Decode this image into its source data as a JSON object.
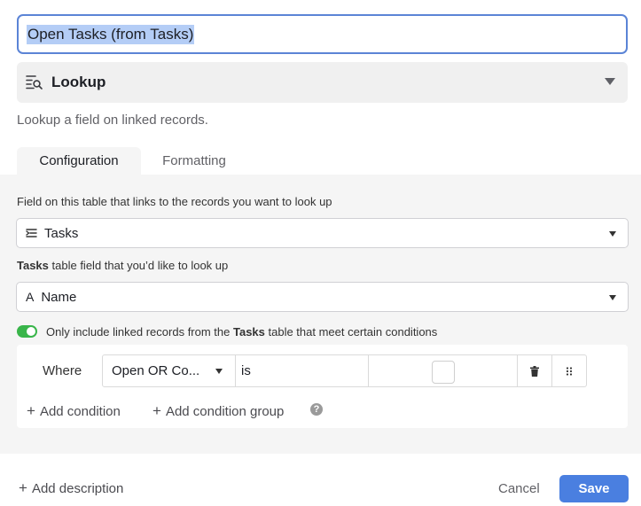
{
  "field": {
    "name_value": "Open Tasks (from Tasks)",
    "type_label": "Lookup",
    "type_description": "Lookup a field on linked records."
  },
  "tabs": [
    {
      "label": "Configuration",
      "active": true
    },
    {
      "label": "Formatting",
      "active": false
    }
  ],
  "config": {
    "link_field_label": "Field on this table that links to the records you want to look up",
    "link_field_value": "Tasks",
    "lookup_field_label_bold": "Tasks",
    "lookup_field_label_rest": " table field that you’d like to look up",
    "lookup_field_value": "Name",
    "lookup_field_icon": "A",
    "toggle_on": true,
    "toggle_text_before": "Only include linked records from the ",
    "toggle_text_bold": "Tasks",
    "toggle_text_after": " table that meet certain conditions"
  },
  "conditions": {
    "where_label": "Where",
    "rows": [
      {
        "field": "Open OR Co...",
        "operator": "is",
        "value_checked": false
      }
    ],
    "add_condition_label": "Add condition",
    "add_group_label": "Add condition group",
    "help_glyph": "?"
  },
  "footer": {
    "add_description_label": "Add description",
    "cancel_label": "Cancel",
    "save_label": "Save"
  },
  "colors": {
    "accent": "#4a7fe0",
    "selection": "#b4cdf6",
    "toggle_on": "#39b54a"
  },
  "icons": {
    "plus": "+"
  }
}
